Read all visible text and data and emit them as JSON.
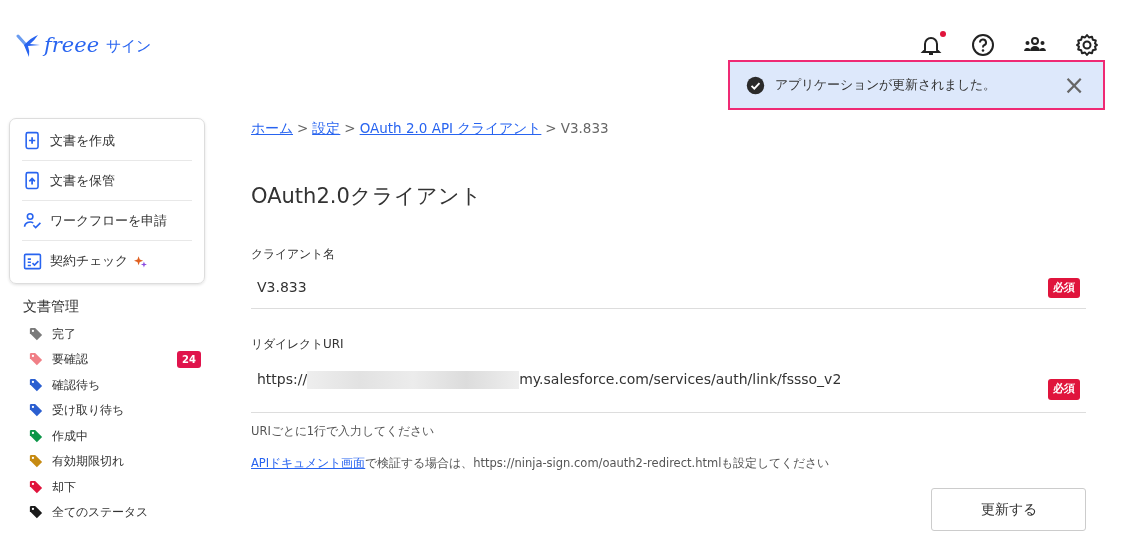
{
  "logo": {
    "text": "freee",
    "suffix": "サイン"
  },
  "header_icons": [
    {
      "kind": "bell",
      "unread": true
    },
    {
      "kind": "help"
    },
    {
      "kind": "team"
    },
    {
      "kind": "settings"
    }
  ],
  "toast": {
    "message": "アプリケーションが更新されました。",
    "close": "×"
  },
  "sidebar": {
    "actions": [
      {
        "kind": "create",
        "label": "文書を作成"
      },
      {
        "kind": "store",
        "label": "文書を保管"
      },
      {
        "kind": "workflow",
        "label": "ワークフローを申請"
      },
      {
        "kind": "check",
        "label": "契約チェック",
        "sparkle": true
      }
    ],
    "section_title": "文書管理",
    "statuses": [
      {
        "label": "完了",
        "color": "#7a7a7a"
      },
      {
        "label": "要確認",
        "color": "#f07f86",
        "count": "24"
      },
      {
        "label": "確認待ち",
        "color": "#2b5fd0"
      },
      {
        "label": "受け取り待ち",
        "color": "#2b5fd0"
      },
      {
        "label": "作成中",
        "color": "#0c9648"
      },
      {
        "label": "有効期限切れ",
        "color": "#c68a12"
      },
      {
        "label": "却下",
        "color": "#e0143c"
      },
      {
        "label": "全てのステータス",
        "color": "#1a1a1a"
      }
    ]
  },
  "breadcrumb": {
    "links": [
      "ホーム",
      "設定",
      "OAuth 2.0 API クライアント"
    ],
    "current": "V3.833",
    "separator": ">"
  },
  "title": "OAuth2.0クライアント",
  "fields": [
    {
      "label": "クライアント名",
      "value": "V3.833",
      "required": "必須"
    },
    {
      "label": "リダイレクトURI",
      "value_prefix": "https://",
      "redacted": true,
      "value_suffix": "my.salesforce.com/services/auth/link/fssso_v2",
      "required": "必須"
    }
  ],
  "hint": "URIごとに1行で入力してください",
  "doc_note": {
    "link": "APIドキュメント画面",
    "text": "で検証する場合は、https://ninja-sign.com/oauth2-redirect.htmlも設定してください"
  },
  "submit": "更新する"
}
